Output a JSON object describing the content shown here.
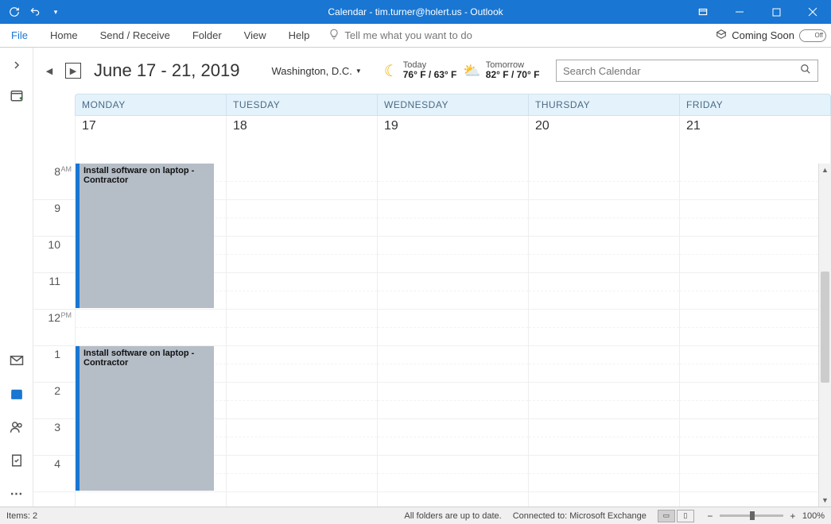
{
  "titlebar": {
    "title": "Calendar - tim.turner@holert.us - Outlook"
  },
  "ribbon": {
    "tabs": [
      "File",
      "Home",
      "Send / Receive",
      "Folder",
      "View",
      "Help"
    ],
    "tell_placeholder": "Tell me what you want to do",
    "coming_soon": "Coming Soon",
    "switch_label": "Off"
  },
  "calhead": {
    "date_range": "June 17 - 21, 2019",
    "location": "Washington,  D.C.",
    "today_label": "Today",
    "today_temp": "76° F / 63° F",
    "tomorrow_label": "Tomorrow",
    "tomorrow_temp": "82° F / 70° F",
    "search_placeholder": "Search Calendar"
  },
  "days": {
    "headers": [
      "MONDAY",
      "TUESDAY",
      "WEDNESDAY",
      "THURSDAY",
      "FRIDAY"
    ],
    "dates": [
      "17",
      "18",
      "19",
      "20",
      "21"
    ]
  },
  "hours": [
    {
      "h": "8",
      "ampm": "AM"
    },
    {
      "h": "9",
      "ampm": ""
    },
    {
      "h": "10",
      "ampm": ""
    },
    {
      "h": "11",
      "ampm": ""
    },
    {
      "h": "12",
      "ampm": "PM"
    },
    {
      "h": "1",
      "ampm": ""
    },
    {
      "h": "2",
      "ampm": ""
    },
    {
      "h": "3",
      "ampm": ""
    },
    {
      "h": "4",
      "ampm": ""
    }
  ],
  "events": [
    {
      "title": "Install software on laptop - Contractor",
      "day": 0,
      "start": 0,
      "span": 4
    },
    {
      "title": "Install software on laptop - Contractor",
      "day": 0,
      "start": 5,
      "span": 4
    }
  ],
  "statusbar": {
    "items": "Items: 2",
    "folders": "All folders are up to date.",
    "connected": "Connected to: Microsoft Exchange",
    "zoom": "100%"
  }
}
